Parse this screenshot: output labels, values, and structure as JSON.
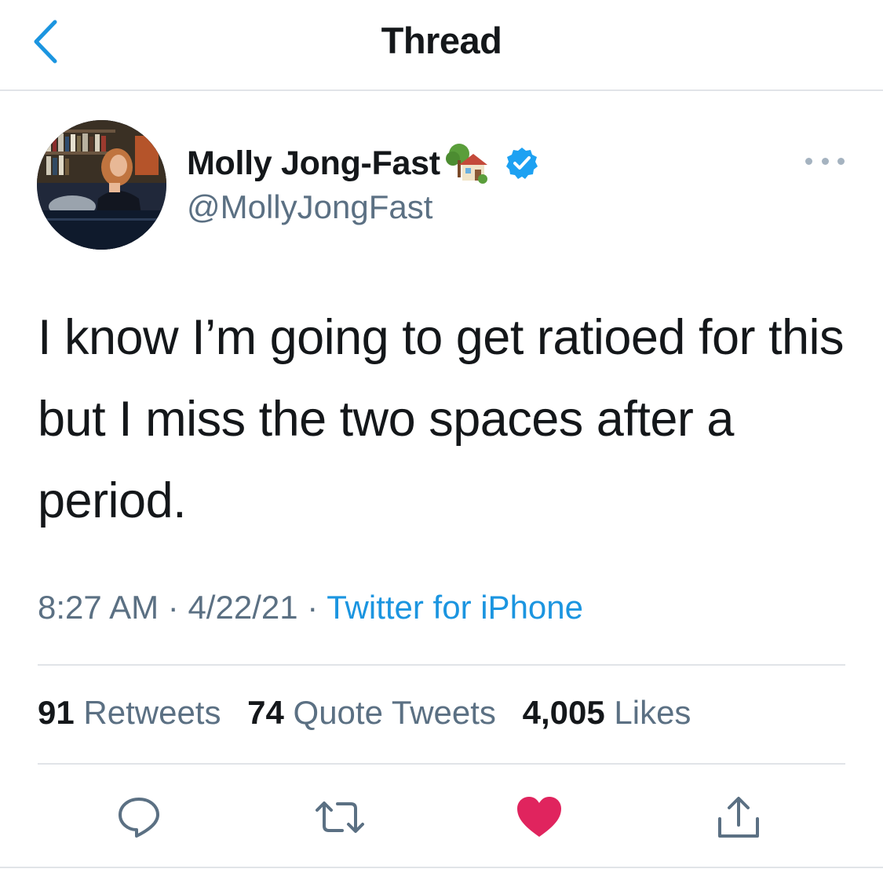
{
  "header": {
    "title": "Thread",
    "back_icon": "chevron-left-icon",
    "accent": "#1b95e0"
  },
  "tweet": {
    "author": {
      "display_name": "Molly Jong-Fast",
      "handle": "@MollyJongFast",
      "verified": true,
      "name_emoji_icon": "house-with-garden-icon",
      "avatar_icon": "profile-photo"
    },
    "text": "I know I’m going to get ratioed for this but I miss the two spaces after a period.",
    "time": "8:27 AM",
    "separator": "·",
    "date": "4/22/21",
    "source": "Twitter for iPhone",
    "stats": {
      "retweets_count": "91",
      "retweets_label": "Retweets",
      "quotes_count": "74",
      "quotes_label": "Quote Tweets",
      "likes_count": "4,005",
      "likes_label": "Likes"
    },
    "liked": true
  },
  "actions": {
    "reply_icon": "reply-icon",
    "retweet_icon": "retweet-icon",
    "like_icon": "heart-icon",
    "share_icon": "share-icon",
    "like_color": "#e0245e",
    "icon_color": "#5b7083"
  }
}
